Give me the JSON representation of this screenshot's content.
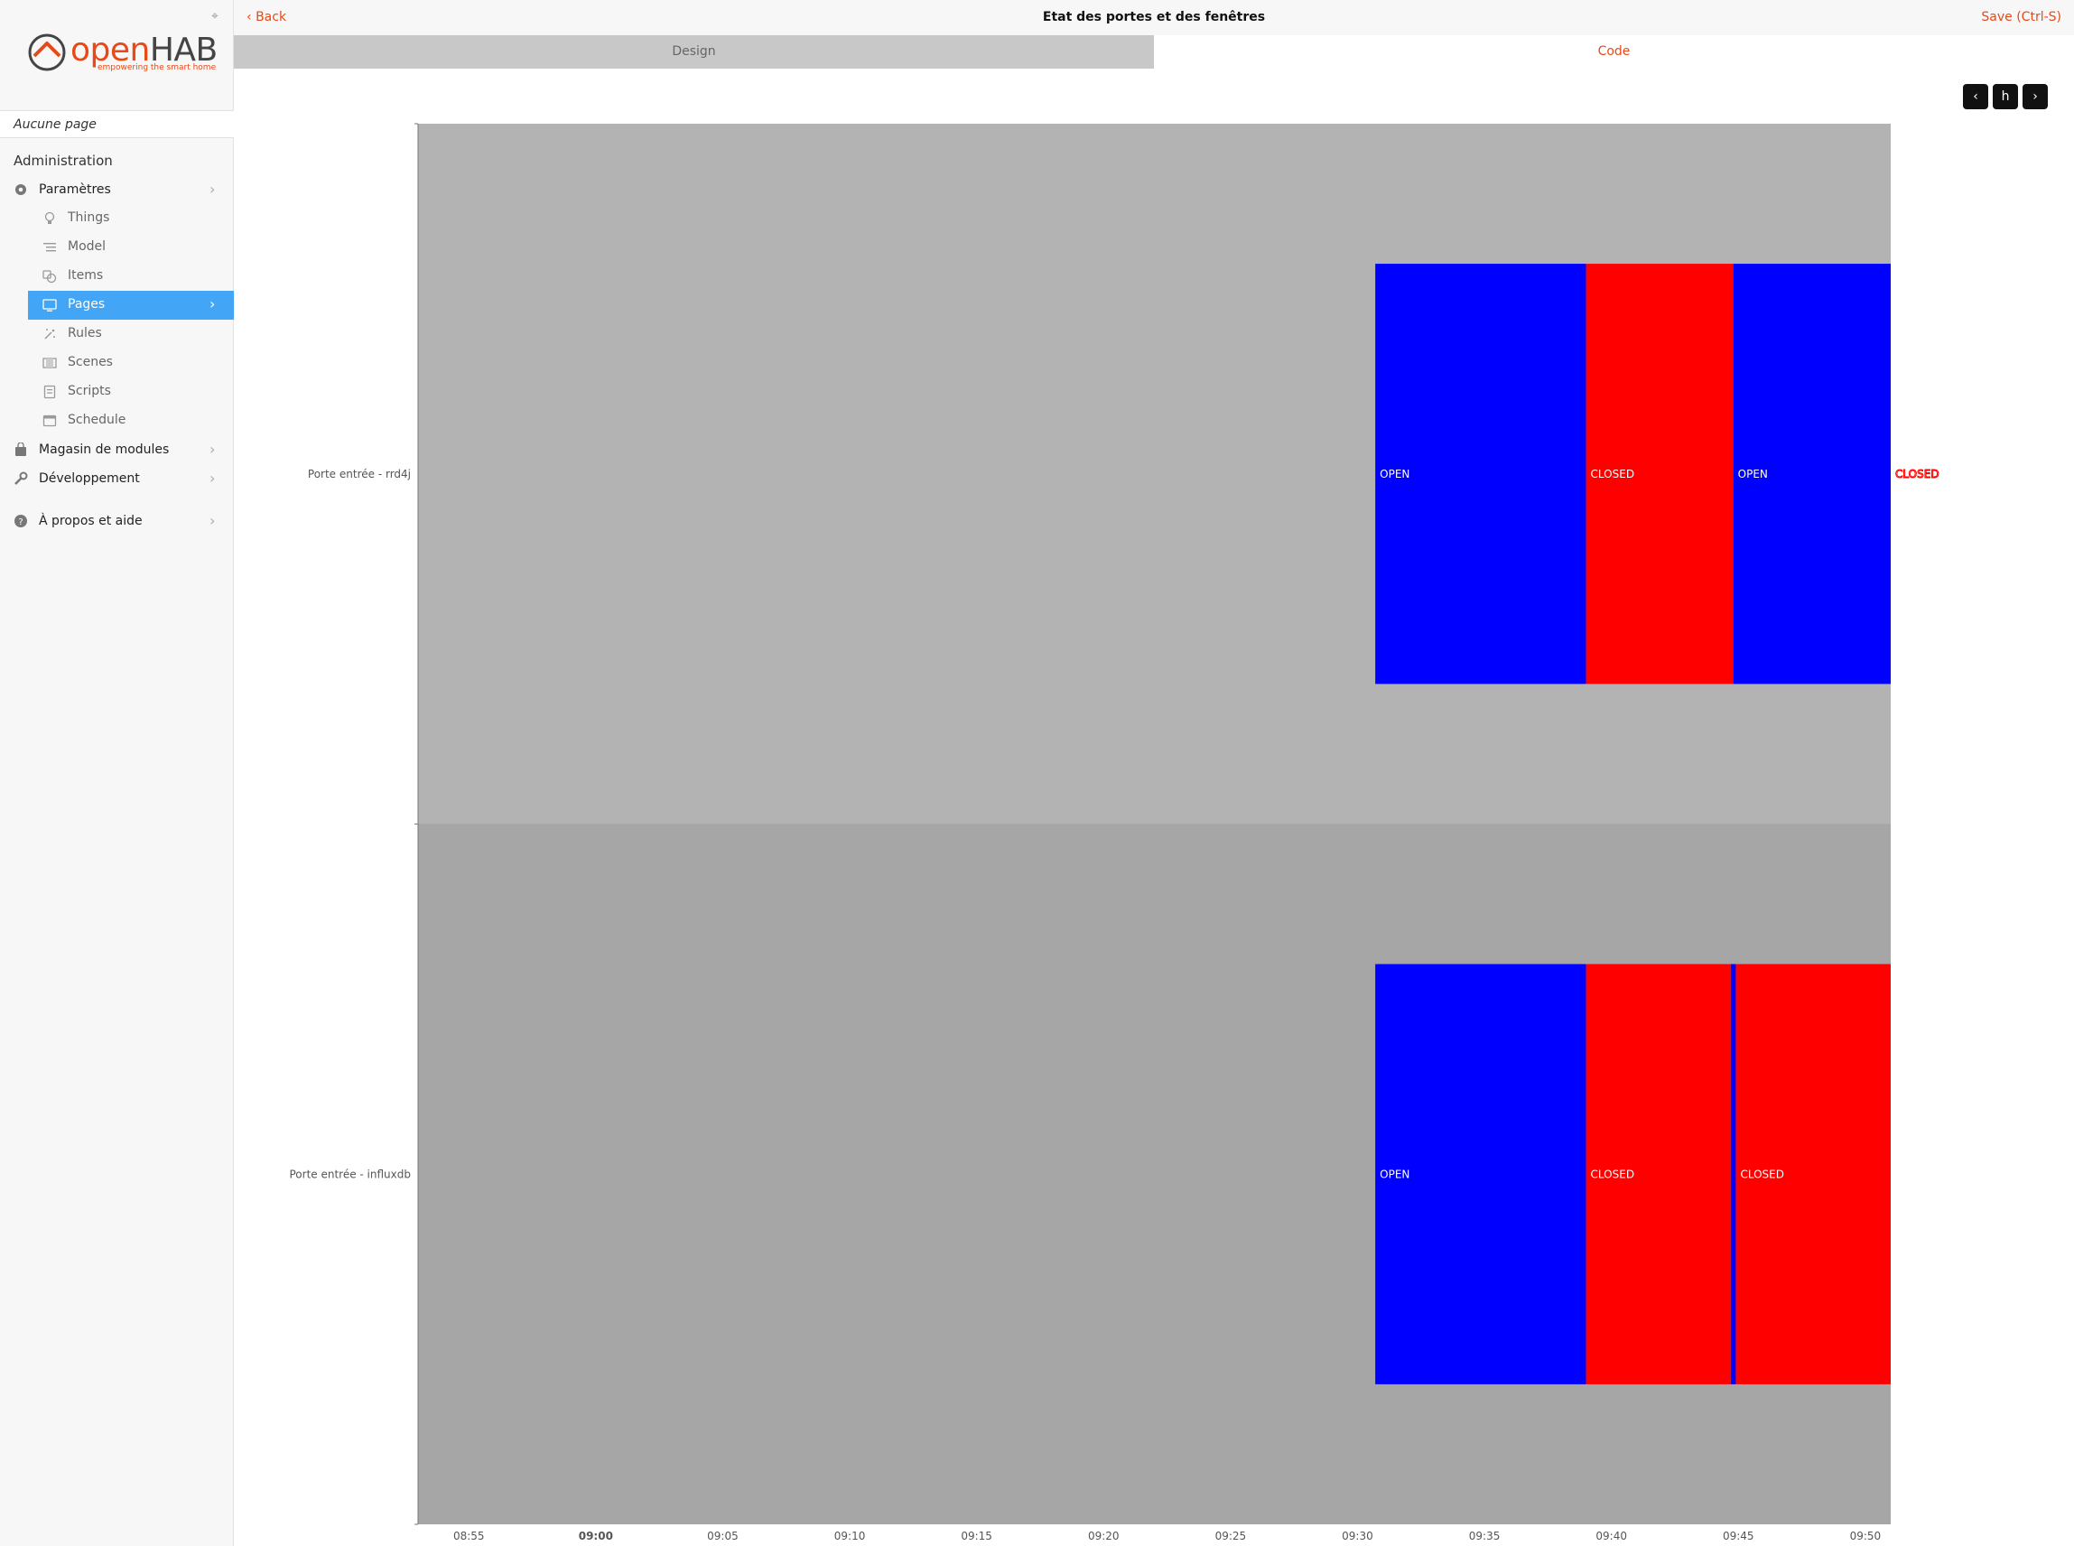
{
  "app": {
    "logo_open": "open",
    "logo_hab": "HAB",
    "logo_tagline": "empowering the smart home",
    "no_page": "Aucune page"
  },
  "sidebar": {
    "section_title": "Administration",
    "settings": {
      "label": "Paramètres",
      "icon": "gear-icon"
    },
    "sub_items": [
      {
        "label": "Things",
        "icon": "lightbulb-icon"
      },
      {
        "label": "Model",
        "icon": "list-icon"
      },
      {
        "label": "Items",
        "icon": "shapes-icon"
      },
      {
        "label": "Pages",
        "icon": "monitor-icon",
        "active": true
      },
      {
        "label": "Rules",
        "icon": "wand-icon"
      },
      {
        "label": "Scenes",
        "icon": "film-icon"
      },
      {
        "label": "Scripts",
        "icon": "script-icon"
      },
      {
        "label": "Schedule",
        "icon": "calendar-icon"
      }
    ],
    "addons": {
      "label": "Magasin de modules",
      "icon": "bag-icon"
    },
    "developer": {
      "label": "Développement",
      "icon": "wrench-icon"
    },
    "about": {
      "label": "À propos et aide",
      "icon": "help-icon"
    }
  },
  "toolbar": {
    "back_label": "Back",
    "title": "Etat des portes et des fenêtres",
    "save_label": "Save (Ctrl-S)"
  },
  "tabs": {
    "design": "Design",
    "code": "Code"
  },
  "timeline_controls": {
    "prev": "‹",
    "zoom": "h",
    "next": "›"
  },
  "colors": {
    "accent": "#e64a19",
    "active": "#42a5f5",
    "open": "#0000ff",
    "closed": "#ff0000",
    "band1": "#b3b3b3",
    "band2": "#a6a6a6"
  },
  "chart_data": {
    "type": "timeline",
    "x_ticks": [
      "08:55",
      "09:00",
      "09:05",
      "09:10",
      "09:15",
      "09:20",
      "09:25",
      "09:30",
      "09:35",
      "09:40",
      "09:45",
      "09:50"
    ],
    "x_bold_tick": "09:00",
    "xlim": [
      "08:53",
      "09:51"
    ],
    "rows": [
      {
        "name": "Porte entrée - rrd4j",
        "segments": [
          {
            "start": "09:30.7",
            "end": "09:39.0",
            "state": "OPEN"
          },
          {
            "start": "09:39.0",
            "end": "09:44.8",
            "state": "CLOSED"
          },
          {
            "start": "09:44.8",
            "end": "09:51.0",
            "state": "OPEN"
          }
        ],
        "trailing_label": "CLOSED"
      },
      {
        "name": "Porte entrée - influxdb",
        "segments": [
          {
            "start": "09:30.7",
            "end": "09:39.0",
            "state": "OPEN"
          },
          {
            "start": "09:39.0",
            "end": "09:44.7",
            "state": "CLOSED"
          },
          {
            "start": "09:44.7",
            "end": "09:44.9",
            "state": "OPEN"
          },
          {
            "start": "09:44.9",
            "end": "09:51.0",
            "state": "CLOSED"
          }
        ]
      }
    ]
  }
}
